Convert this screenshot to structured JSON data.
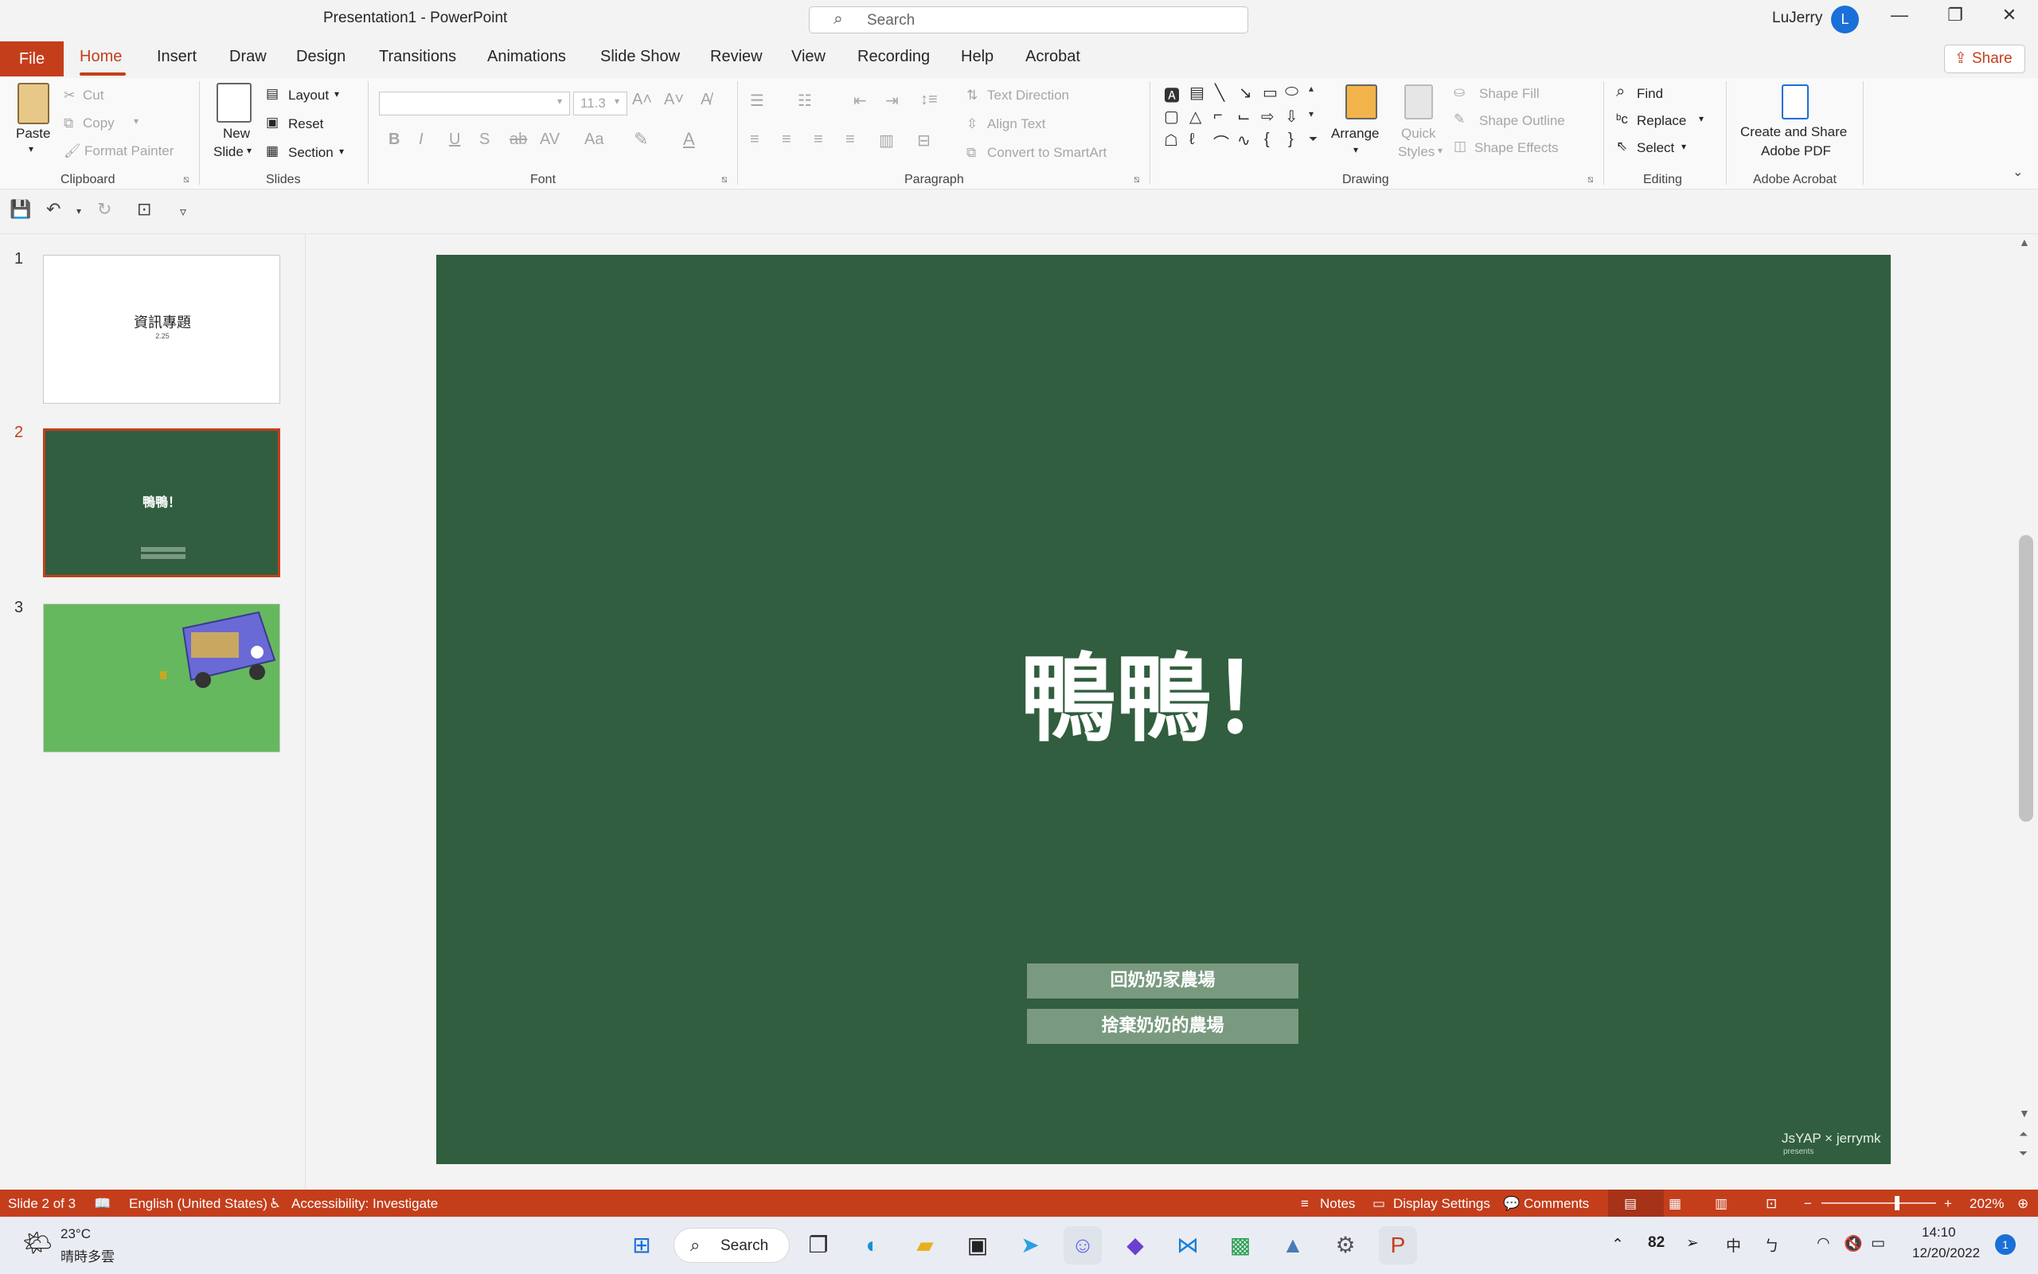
{
  "window": {
    "title": "Presentation1  -  PowerPoint",
    "search_placeholder": "Search",
    "user_name": "LuJerry",
    "user_initial": "L"
  },
  "tabs": [
    "File",
    "Home",
    "Insert",
    "Draw",
    "Design",
    "Transitions",
    "Animations",
    "Slide Show",
    "Review",
    "View",
    "Recording",
    "Help",
    "Acrobat"
  ],
  "share_label": "Share",
  "ribbon": {
    "clipboard": {
      "paste": "Paste",
      "cut": "Cut",
      "copy": "Copy",
      "format_painter": "Format Painter",
      "group": "Clipboard"
    },
    "slides": {
      "new_slide_1": "New",
      "new_slide_2": "Slide",
      "layout": "Layout",
      "reset": "Reset",
      "section": "Section",
      "group": "Slides"
    },
    "font": {
      "size": "11.3",
      "group": "Font"
    },
    "paragraph": {
      "text_direction": "Text Direction",
      "align_text": "Align Text",
      "smartart": "Convert to SmartArt",
      "group": "Paragraph"
    },
    "drawing": {
      "arrange": "Arrange",
      "quick_styles_1": "Quick",
      "quick_styles_2": "Styles",
      "shape_fill": "Shape Fill",
      "shape_outline": "Shape Outline",
      "shape_effects": "Shape Effects",
      "group": "Drawing"
    },
    "editing": {
      "find": "Find",
      "replace": "Replace",
      "select": "Select",
      "group": "Editing"
    },
    "acrobat": {
      "create_1": "Create and Share",
      "create_2": "Adobe PDF",
      "group": "Adobe Acrobat"
    }
  },
  "thumbnails": [
    {
      "number": "1",
      "title": "資訊專題",
      "subtitle": "2.25"
    },
    {
      "number": "2",
      "title": "鴨鴨！"
    },
    {
      "number": "3"
    }
  ],
  "slide": {
    "title": "鴨鴨！",
    "button1": "回奶奶家農場",
    "button2": "捨棄奶奶的農場",
    "credit": "JsYAP × jerrymk",
    "credit_sub": "presents",
    "bg_color": "#315e3e"
  },
  "status": {
    "slide_info": "Slide 2 of 3",
    "language": "English (United States)",
    "accessibility": "Accessibility: Investigate",
    "notes": "Notes",
    "display_settings": "Display Settings",
    "comments": "Comments",
    "zoom": "202%"
  },
  "taskbar": {
    "weather_temp": "23°C",
    "weather_desc": "晴時多雲",
    "search": "Search",
    "tray_lang": "中",
    "time": "14:10",
    "date": "12/20/2022",
    "notif_count": "1"
  }
}
